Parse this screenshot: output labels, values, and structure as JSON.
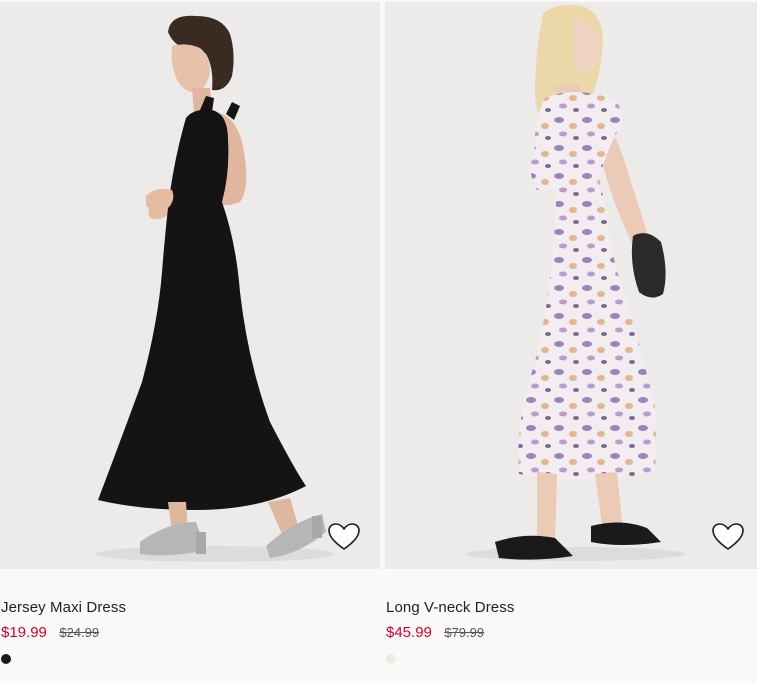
{
  "products": [
    {
      "title": "Jersey Maxi Dress",
      "sale_price": "$19.99",
      "original_price": "$24.99",
      "swatch_color": "#1a1a1a",
      "image_background": "#ecebea",
      "favorite_icon": "heart-outline-icon"
    },
    {
      "title": "Long V-neck Dress",
      "sale_price": "$45.99",
      "original_price": "$79.99",
      "swatch_color": "#ecebe2",
      "image_background": "#ecebea",
      "favorite_icon": "heart-outline-icon"
    }
  ],
  "colors": {
    "sale_price": "#d6002f",
    "title_text": "#222222",
    "strike_price": "#555555",
    "page_background": "#faf9f8"
  }
}
